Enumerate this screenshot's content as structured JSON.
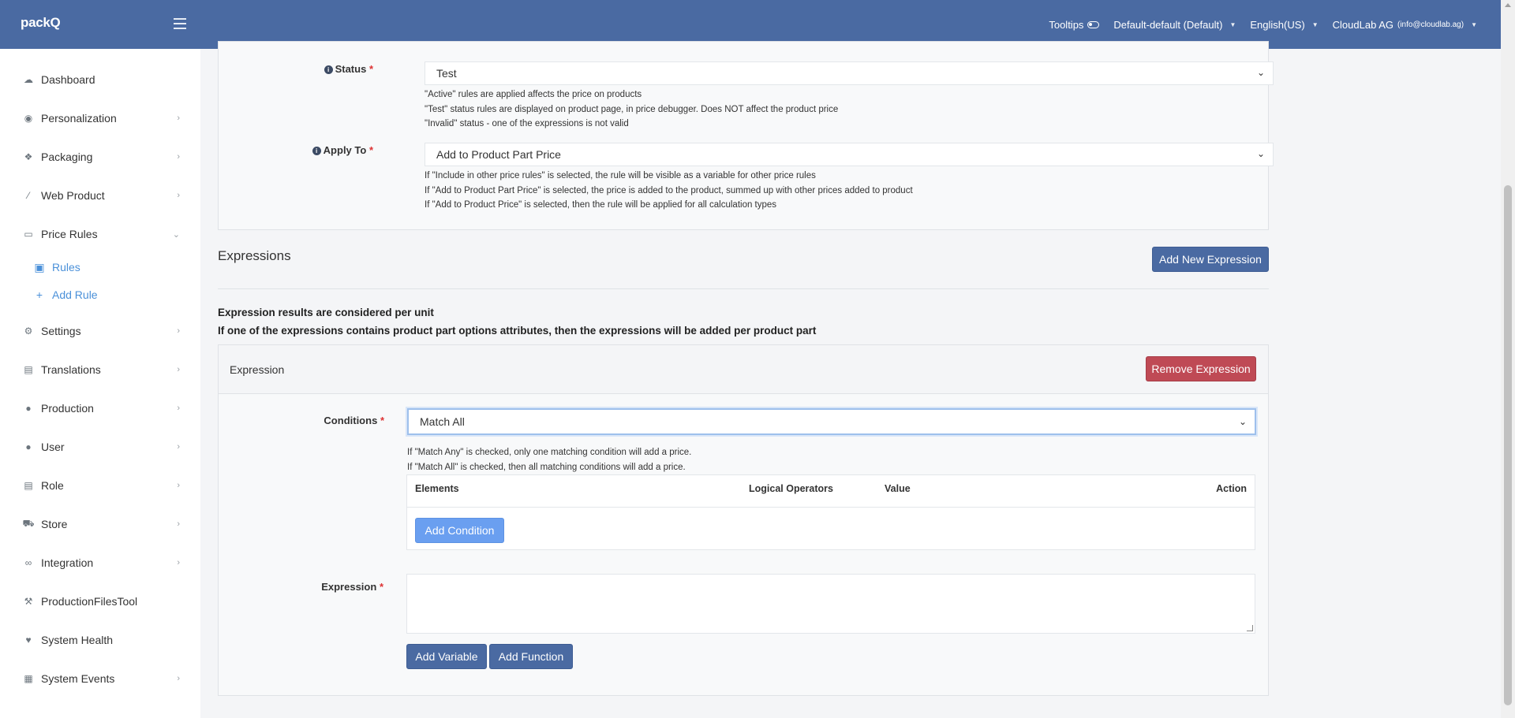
{
  "header": {
    "logo": "packQ",
    "tooltips_label": "Tooltips",
    "config_selector": "Default-default (Default)",
    "language_selector": "English(US)",
    "account_name": "CloudLab AG",
    "account_email": "(info@cloudlab.ag)"
  },
  "sidebar": {
    "items": [
      {
        "label": "Dashboard",
        "icon": "cloud-icon"
      },
      {
        "label": "Personalization",
        "icon": "eye-icon"
      },
      {
        "label": "Packaging",
        "icon": "cubes-icon"
      },
      {
        "label": "Web Product",
        "icon": "magic-wand-icon"
      },
      {
        "label": "Price Rules",
        "icon": "money-icon"
      },
      {
        "label": "Settings",
        "icon": "gears-icon"
      },
      {
        "label": "Translations",
        "icon": "translate-icon"
      },
      {
        "label": "Production",
        "icon": "production-icon"
      },
      {
        "label": "User",
        "icon": "user-icon"
      },
      {
        "label": "Role",
        "icon": "id-card-icon"
      },
      {
        "label": "Store",
        "icon": "cart-icon"
      },
      {
        "label": "Integration",
        "icon": "link-icon"
      },
      {
        "label": "ProductionFilesTool",
        "icon": "wrench-icon"
      },
      {
        "label": "System Health",
        "icon": "heartbeat-icon"
      },
      {
        "label": "System Events",
        "icon": "calendar-icon"
      }
    ],
    "price_rules_sub": {
      "rules": "Rules",
      "add_rule": "Add Rule"
    }
  },
  "form": {
    "status": {
      "label": "Status",
      "value": "Test",
      "help": [
        "\"Active\" rules are applied affects the price on products",
        "\"Test\" status rules are displayed on product page, in price debugger. Does NOT affect the product price",
        "\"Invalid\" status - one of the expressions is not valid"
      ]
    },
    "apply_to": {
      "label": "Apply To",
      "value": "Add to Product Part Price",
      "help": [
        "If \"Include in other price rules\" is selected, the rule will be visible as a variable for other price rules",
        "If \"Add to Product Part Price\" is selected, the price is added to the product, summed up with other prices added to product",
        "If \"Add to Product Price\" is selected, then the rule will be applied for all calculation types"
      ]
    },
    "required_mark": "*"
  },
  "expressions": {
    "title": "Expressions",
    "add_button": "Add New Expression",
    "note_1": "Expression results are considered per unit",
    "note_2": "If one of the expressions contains product part options attributes, then the expressions will be added per product part",
    "card_title": "Expression",
    "remove_button": "Remove Expression",
    "conditions_label": "Conditions",
    "conditions_value": "Match All",
    "conditions_help": [
      "If \"Match Any\" is checked, only one matching condition will add a price.",
      "If \"Match All\" is checked, then all matching conditions will add a price."
    ],
    "table_headers": {
      "elements": "Elements",
      "logical_operators": "Logical Operators",
      "value": "Value",
      "action": "Action"
    },
    "add_condition_button": "Add Condition",
    "expression_label": "Expression",
    "expression_value": "",
    "add_variable_button": "Add Variable",
    "add_function_button": "Add Function"
  },
  "colors": {
    "header_bg": "#4a6aa2",
    "primary_button": "#4a6aa2",
    "danger_button": "#bf4a55",
    "link_blue": "#4a90d9"
  }
}
